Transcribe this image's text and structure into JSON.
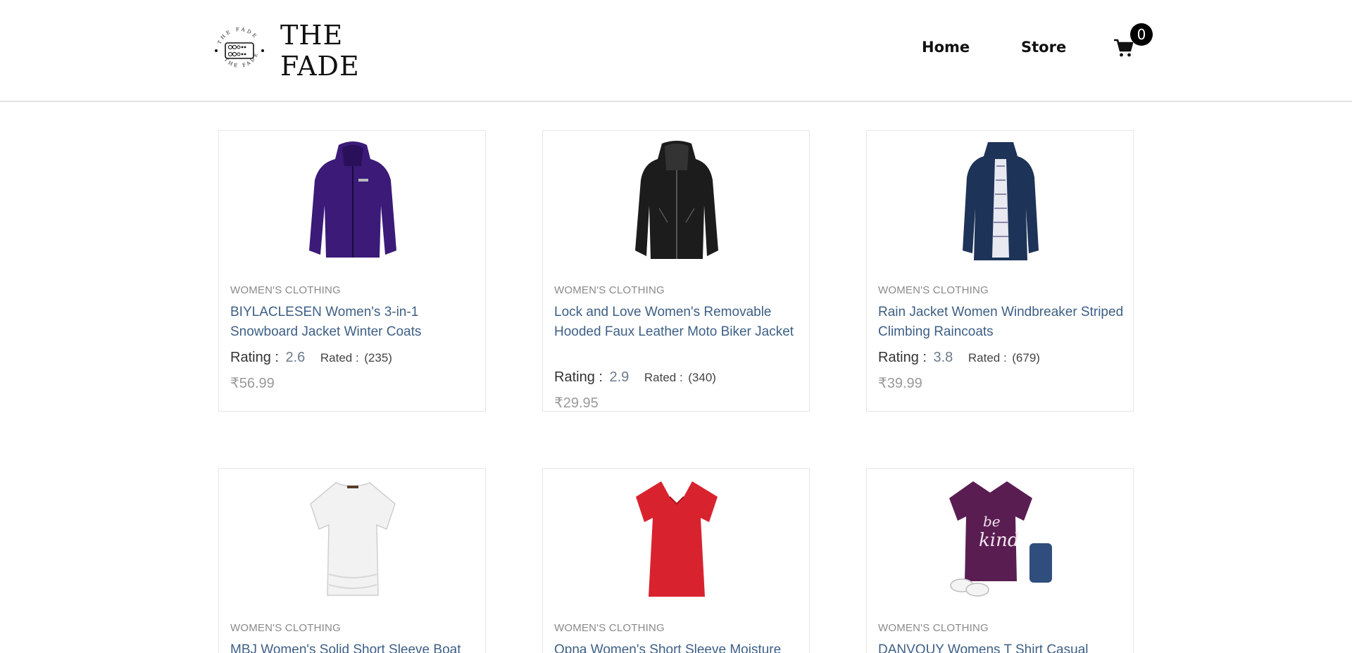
{
  "brand": {
    "name": "THE FADE",
    "ring_text": "THE FADE"
  },
  "nav": {
    "home": "Home",
    "store": "Store"
  },
  "cart": {
    "count": "0"
  },
  "products": [
    {
      "category": "WOMEN'S CLOTHING",
      "title": "BIYLACLESEN Women's 3-in-1 Snowboard Jacket Winter Coats",
      "rating_label": "Rating :",
      "rating": "2.6",
      "rated_label": "Rated :",
      "rated_count": "(235)",
      "price": "₹56.99",
      "image": "purple-jacket"
    },
    {
      "category": "WOMEN'S CLOTHING",
      "title": "Lock and Love Women's Removable Hooded Faux Leather Moto Biker Jacket",
      "rating_label": "Rating :",
      "rating": "2.9",
      "rated_label": "Rated :",
      "rated_count": "(340)",
      "price": "₹29.95",
      "image": "black-leather-jacket"
    },
    {
      "category": "WOMEN'S CLOTHING",
      "title": "Rain Jacket Women Windbreaker Striped Climbing Raincoats",
      "rating_label": "Rating :",
      "rating": "3.8",
      "rated_label": "Rated :",
      "rated_count": "(679)",
      "price": "₹39.99",
      "image": "navy-raincoat"
    },
    {
      "category": "WOMEN'S CLOTHING",
      "title": "MBJ Women's Solid Short Sleeve Boat Neck V",
      "image": "white-top"
    },
    {
      "category": "WOMEN'S CLOTHING",
      "title": "Opna Women's Short Sleeve Moisture",
      "image": "red-tshirt"
    },
    {
      "category": "WOMEN'S CLOTHING",
      "title": "DANVOUY Womens T Shirt Casual Cotton Short",
      "image": "purple-be-kind-tshirt"
    }
  ],
  "colors": {
    "title_link": "#3d5f85",
    "category": "#8a8a8a",
    "price": "#9a9a9a",
    "purple": "#3b1a78",
    "navy": "#1d3357",
    "red": "#d8232f"
  }
}
